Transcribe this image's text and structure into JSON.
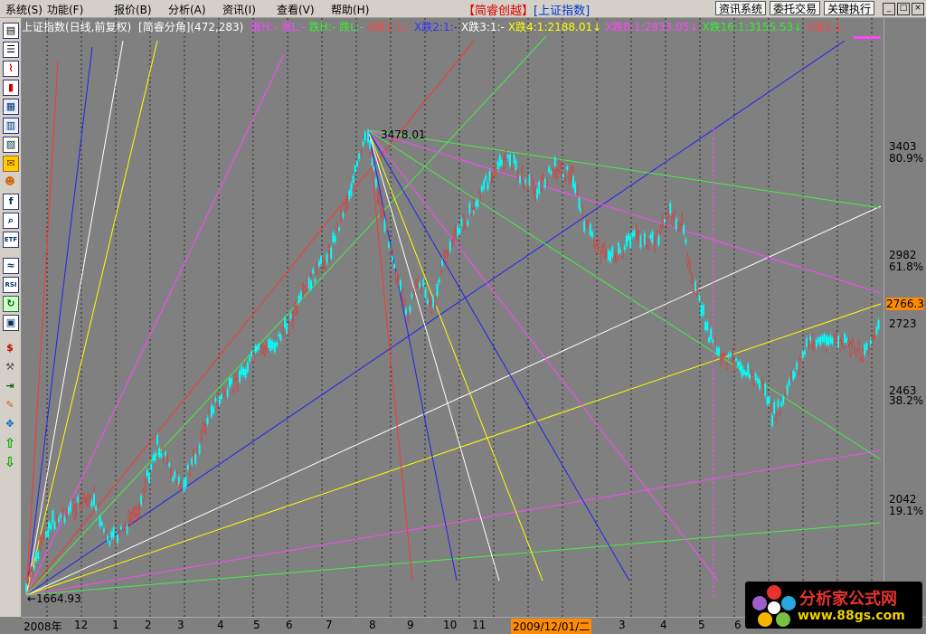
{
  "menubar": {
    "items": [
      "系统(S)",
      "功能(F)",
      "报价(B)",
      "分析(A)",
      "资讯(I)",
      "查看(V)",
      "帮助(H)"
    ],
    "brand": "【简睿创越】",
    "index": "[上证指数]",
    "buttons": [
      "资讯系统",
      "委托交易",
      "关键执行"
    ],
    "window_buttons": [
      "_",
      "□",
      "×"
    ]
  },
  "status": {
    "title": "上证指数(日线,前复权)",
    "indicator": "[简睿分角](472,283)",
    "items": [
      {
        "text": "涨H:-",
        "color": "#ff44ff"
      },
      {
        "text": "涨L:-",
        "color": "#ff44ff"
      },
      {
        "text": "跌H:-",
        "color": "#33ee33"
      },
      {
        "text": "跌L:-",
        "color": "#33ee33"
      },
      {
        "text": "X跌1:1:-",
        "color": "#ff4444"
      },
      {
        "text": "X跌2:1:-",
        "color": "#3333ff"
      },
      {
        "text": "X跌3:1:-",
        "color": "#ffffff"
      },
      {
        "text": "X跌4:1:2188.01↓",
        "color": "#ffff00"
      },
      {
        "text": "X跌8:1:2833.05↓",
        "color": "#ff44ff"
      },
      {
        "text": "X跌16:1:3155.53↓",
        "color": "#33ee33"
      },
      {
        "text": "X涨1:1",
        "color": "#ff4444"
      }
    ]
  },
  "chart": {
    "peak_label": "3478.01",
    "low_label": "←1664.93"
  },
  "right_axis": {
    "labels": [
      "3403",
      "80.9%",
      "2982",
      "61.8%",
      "2723",
      "2463",
      "38.2%",
      "2042",
      "19.1%"
    ],
    "current_price": "2766.3"
  },
  "bottom_axis": {
    "labels": [
      "2008年",
      "12",
      "1",
      "2",
      "3",
      "4",
      "5",
      "6",
      "7",
      "8",
      "9",
      "10",
      "11",
      "2009/12/01/二",
      "3",
      "4",
      "5",
      "6"
    ]
  },
  "logo": {
    "title": "分析家公式网",
    "url": "www.88gs.com"
  },
  "colors": {
    "background": "#808080",
    "red": "#ff3333",
    "blue": "#2222ee",
    "white": "#ffffff",
    "yellow": "#ffff00",
    "magenta": "#ff44ff",
    "green": "#44ee44",
    "brand_red": "#dd0000",
    "price_tag": "#ff8c00"
  },
  "icons": [
    "report-icon",
    "list-icon",
    "line-chart-icon",
    "candle-icon",
    "grid-icon",
    "table-icon",
    "doc-icon",
    "mail-icon",
    "users-icon",
    "fx-icon",
    "zoom-icon",
    "etf-icon",
    "wave-icon",
    "rsi-icon",
    "refresh-icon",
    "calendar-icon",
    "dollar-icon",
    "wrench-icon",
    "export-icon",
    "pencil-icon",
    "move-icon",
    "up-arrow-icon",
    "down-arrow-icon"
  ]
}
